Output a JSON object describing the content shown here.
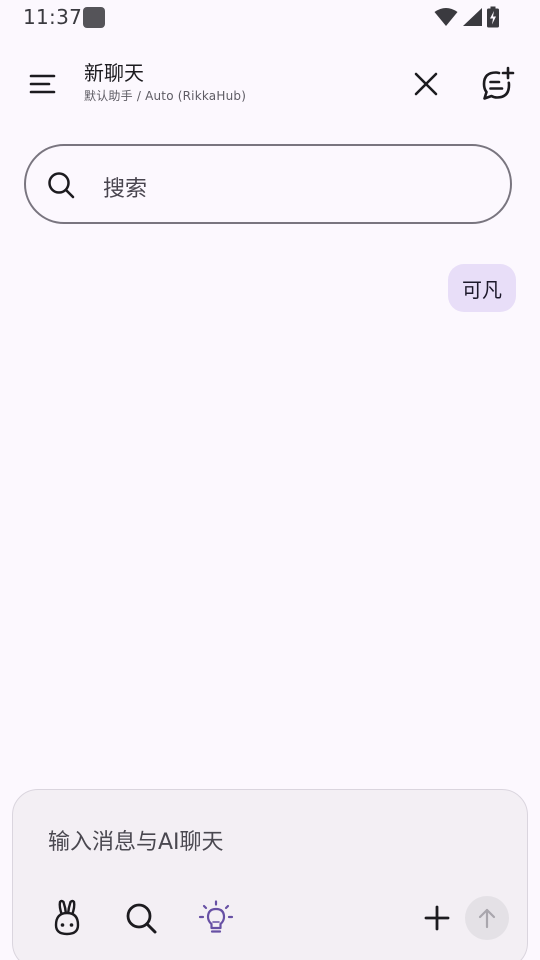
{
  "status_bar": {
    "time": "11:37",
    "icons": [
      "notification-app-icon",
      "wifi-icon",
      "signal-icon",
      "battery-charging-icon"
    ]
  },
  "header": {
    "title": "新聊天",
    "subtitle": "默认助手 / Auto (RikkaHub)",
    "icons": [
      "menu-icon",
      "close-icon",
      "new-chat-icon"
    ]
  },
  "search": {
    "placeholder": "搜索",
    "icon": "search-icon"
  },
  "messages": [
    {
      "role": "user",
      "text": "可凡"
    }
  ],
  "composer": {
    "placeholder": "输入消息与AI聊天",
    "tools": [
      "model-rabbit-icon",
      "web-search-icon",
      "reasoning-bulb-icon",
      "add-icon"
    ],
    "send_icon": "arrow-up-icon"
  },
  "colors": {
    "background": "#FCF8FE",
    "bubble": "#E8DEF8",
    "accent_purple": "#6750A4",
    "outline": "#79757F"
  }
}
